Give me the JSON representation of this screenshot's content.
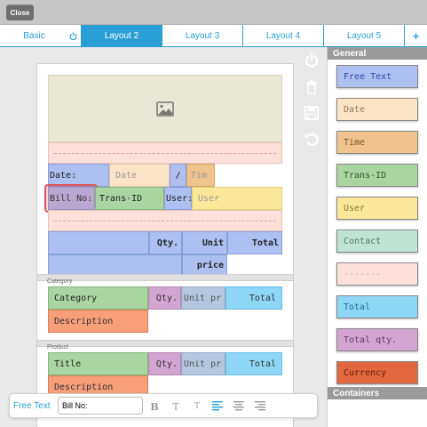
{
  "topbar": {
    "close_label": "Close"
  },
  "tabs": [
    {
      "label": "Basic",
      "active": false
    },
    {
      "label": "Layout 2",
      "active": true
    },
    {
      "label": "Layout 3",
      "active": false
    },
    {
      "label": "Layout 4",
      "active": false
    },
    {
      "label": "Layout 5",
      "active": false
    },
    {
      "label": "+",
      "active": false
    }
  ],
  "canvas": {
    "header": {
      "date_label": "Date:",
      "date_value": "Date",
      "separator": "/",
      "time_value": "Tim",
      "bill_label": "Bill No:",
      "trans_value": "Trans-ID",
      "user_label": "User:",
      "user_value": "User"
    },
    "items_header": {
      "qty": "Qty.",
      "unit": "Unit",
      "total": "Total",
      "price": "price"
    },
    "category": {
      "section_label": "Category",
      "name": "Category",
      "qty": "Qty.",
      "unit_price": "Unit pr",
      "total": "Total",
      "description": "Description"
    },
    "product": {
      "section_label": "Product",
      "name": "Title",
      "qty": "Qty.",
      "unit_price": "Unit pr",
      "total": "Total",
      "description": "Description"
    }
  },
  "panel": {
    "general_label": "General",
    "containers_label": "Containers",
    "items": [
      {
        "label": "Free Text",
        "color": "#aebff2"
      },
      {
        "label": "Date",
        "color": "#fbe3c6"
      },
      {
        "label": "Time",
        "color": "#efc28e"
      },
      {
        "label": "Trans-ID",
        "color": "#a9d5a0"
      },
      {
        "label": "User",
        "color": "#fbe79a"
      },
      {
        "label": "Contact",
        "color": "#bfe3d4"
      },
      {
        "label": "-------",
        "color": "#fde0da"
      },
      {
        "label": "Total",
        "color": "#8ed6f6"
      },
      {
        "label": "Total qty.",
        "color": "#d2a6d1"
      },
      {
        "label": "Currency",
        "color": "#e2673f"
      }
    ]
  },
  "toolbar": {
    "field_type": "Free Text",
    "text_value": "Bill No:",
    "bold": "B",
    "normal": "T",
    "small": "T"
  },
  "colors": {
    "accent": "#2a9fd6",
    "selection": "#e0505c"
  }
}
